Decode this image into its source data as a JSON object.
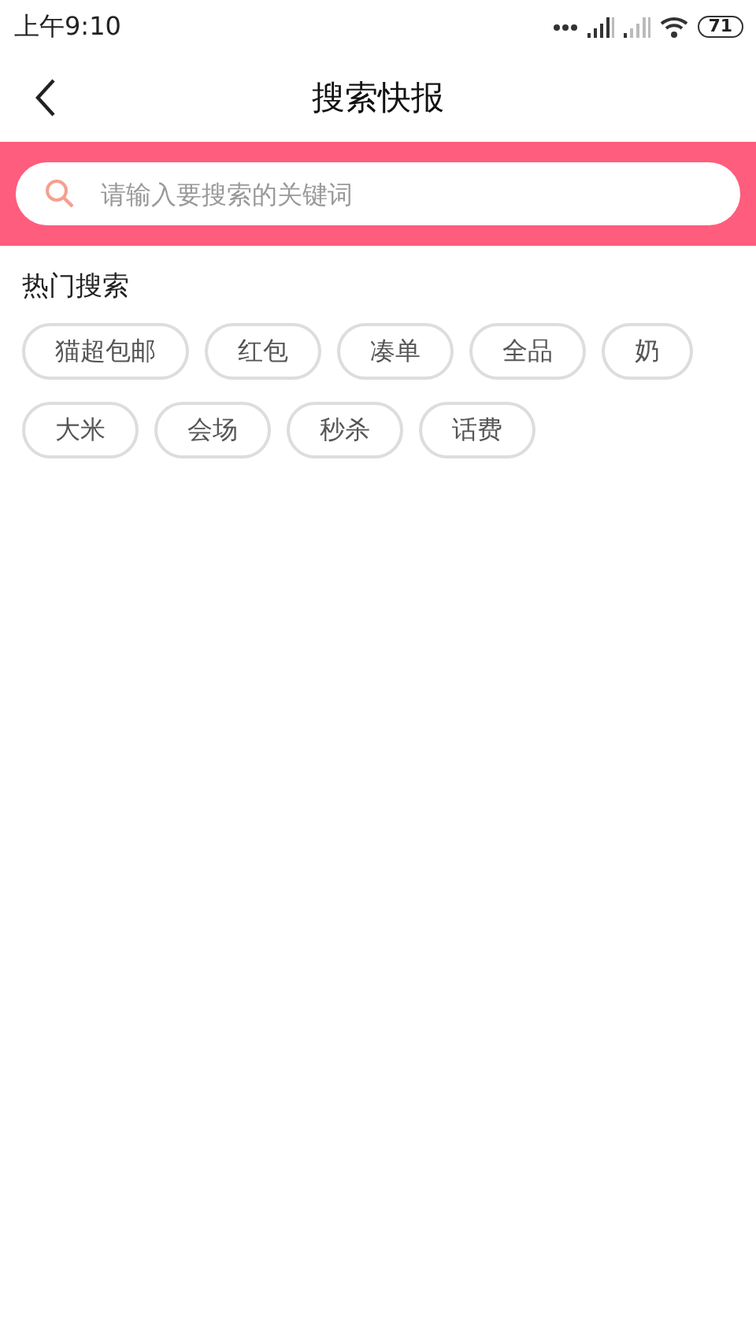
{
  "status_bar": {
    "time": "上午9:10",
    "battery": "71"
  },
  "header": {
    "title": "搜索快报"
  },
  "search": {
    "placeholder": "请输入要搜索的关键词"
  },
  "hot_search": {
    "title": "热门搜索",
    "tags": [
      "猫超包邮",
      "红包",
      "凑单",
      "全品",
      "奶",
      "大米",
      "会场",
      "秒杀",
      "话费"
    ]
  }
}
